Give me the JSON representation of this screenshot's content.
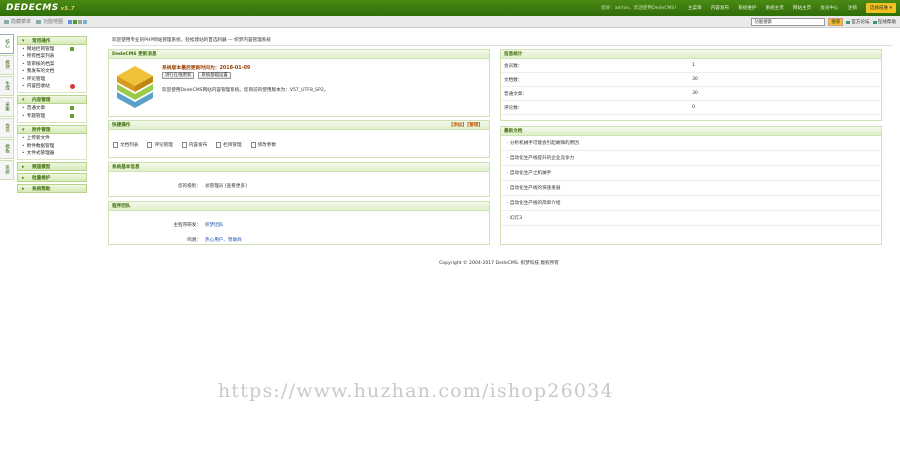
{
  "app": {
    "logo": "DEDECMS",
    "version": "v5.7"
  },
  "topnav": {
    "user": "您好：admin，欢迎使用DedeCMS！",
    "items": [
      "主菜单",
      "内容发布",
      "系统维护",
      "系统主页",
      "网站主页",
      "会员中心",
      "注销"
    ],
    "style_btn": "选择皮肤 ▾"
  },
  "toolbar": {
    "hide_menu": "隐藏菜单",
    "show_menu": "功能地图",
    "search_value": "功能搜索",
    "search_btn": "搜索",
    "official": "官方论坛",
    "online_help": "在线帮助",
    "swatches": [
      "#5a9ad8",
      "#4a9a2a",
      "#a0a0a0",
      "#7ab0d0"
    ]
  },
  "side_tabs": [
    "核心",
    "模块",
    "生成",
    "采集",
    "会员",
    "模板",
    "系统"
  ],
  "menu": [
    {
      "title": "常用操作",
      "items": [
        {
          "label": "网站栏目管理",
          "mark": "plus"
        },
        {
          "label": "所有档案列表",
          "mark": ""
        },
        {
          "label": "等审核的档案",
          "mark": ""
        },
        {
          "label": "我发布的文档",
          "mark": ""
        },
        {
          "label": "评论管理",
          "mark": ""
        },
        {
          "label": "内容回收站",
          "mark": "warn"
        }
      ]
    },
    {
      "title": "内容管理",
      "items": [
        {
          "label": "普通文章",
          "mark": "plus"
        },
        {
          "label": "专题管理",
          "mark": "plus"
        }
      ]
    },
    {
      "title": "附件管理",
      "items": [
        {
          "label": "上传新文件",
          "mark": ""
        },
        {
          "label": "附件数据管理",
          "mark": ""
        },
        {
          "label": "文件式管理器",
          "mark": ""
        }
      ]
    },
    {
      "title": "频道模型",
      "items": []
    },
    {
      "title": "批量维护",
      "items": []
    },
    {
      "title": "系统帮助",
      "items": []
    }
  ],
  "crumb": "欢迎使用专业的PHP网站管理系统，轻松建站的首选利器 — 织梦内容管理系统",
  "news": {
    "title": "DedeCMS 更新消息",
    "date_line": "系统版本最后更新时间为：2018-01-09",
    "btn1": "进行在线更新",
    "btn2": "系统基础设置",
    "welcome": "欢迎使用DedeCMS网站内容管理系统。您目前的使用版本为：V57_UTF8_SP2。"
  },
  "quick": {
    "title": "快捷操作",
    "add": "【添加】【管理】",
    "items": [
      "文档列表",
      "评论管理",
      "内容发布",
      "栏目管理",
      "修改参数"
    ]
  },
  "sysinfo": {
    "title": "系统基本信息",
    "label": "您的级别：",
    "value": "总管理员 [查看更多]"
  },
  "team": {
    "title": "程序团队",
    "dev_label": "主程序研发：",
    "dev_value": "织梦团队",
    "thanks_label": "鸣谢：",
    "thanks_value": "热心用户、赞助商"
  },
  "stats": {
    "title": "信息统计",
    "rows": [
      {
        "k": "会员数：",
        "v": "1"
      },
      {
        "k": "文档数：",
        "v": "30"
      },
      {
        "k": "普通文章：",
        "v": "30"
      },
      {
        "k": "评论数：",
        "v": "0"
      }
    ]
  },
  "latest": {
    "title": "最新文档",
    "items": [
      "· 分析机械手可能会引起故障的原因",
      "· 自动化生产线提升的企业竞争力",
      "· 自动化生产之机械手",
      "· 自动化生产线的快速发展",
      "· 自动化生产线的简单介绍",
      "· 幻灯3"
    ]
  },
  "footer": "Copyright © 2004-2017 DedeCMS. 织梦科技 版权所有",
  "watermark": "https://www.huzhan.com/ishop26034"
}
